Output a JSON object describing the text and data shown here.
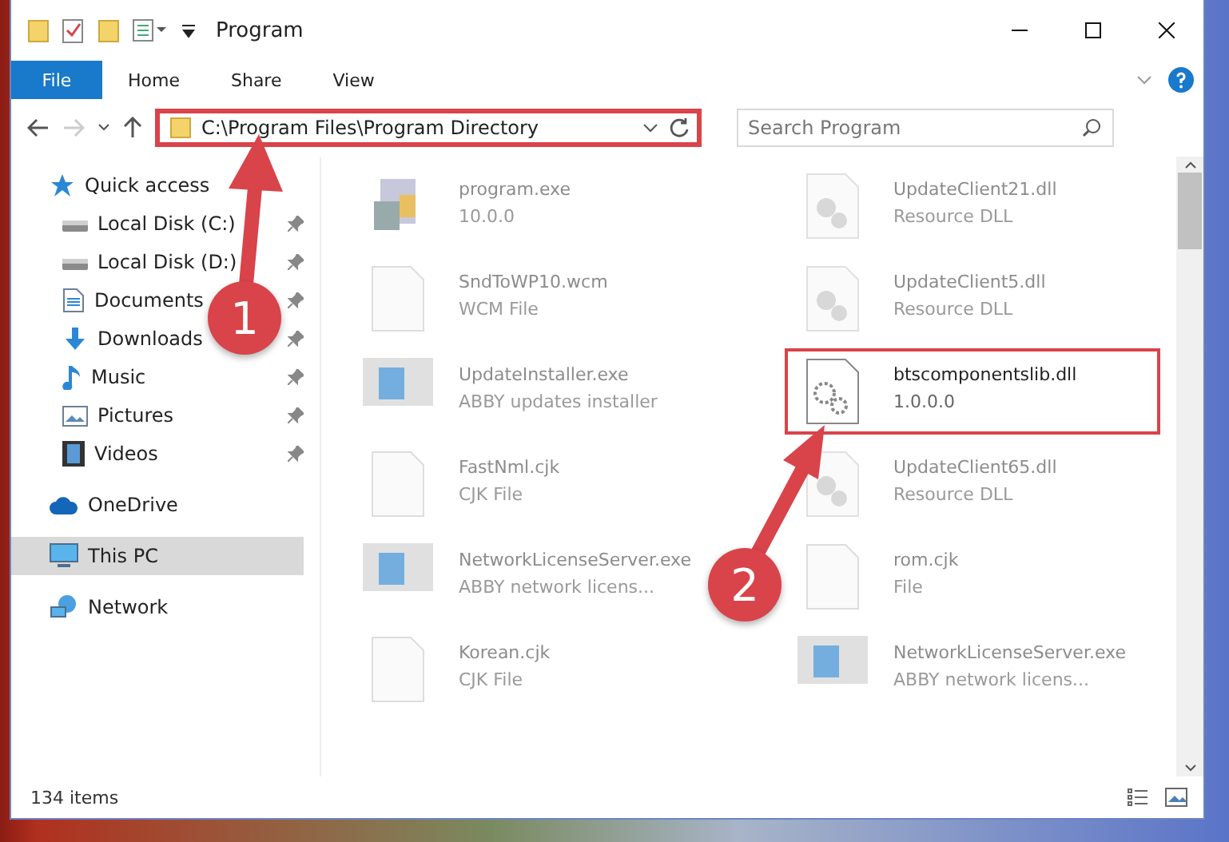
{
  "window": {
    "title": "Program"
  },
  "ribbon_tabs": [
    {
      "label": "File",
      "selected": true
    },
    {
      "label": "Home",
      "selected": false
    },
    {
      "label": "Share",
      "selected": false
    },
    {
      "label": "View",
      "selected": false
    }
  ],
  "address_bar": {
    "path": "C:\\Program Files\\Program Directory",
    "highlighted": true
  },
  "search": {
    "placeholder": "Search Program"
  },
  "sidebar": {
    "items": [
      {
        "label": "Quick access",
        "kind": "star",
        "pinned": false,
        "selected": false,
        "children": [
          {
            "label": "Local Disk (C:)",
            "kind": "disk",
            "pinned": true,
            "selected": false
          },
          {
            "label": "Local Disk (D:)",
            "kind": "disk",
            "pinned": true,
            "selected": false
          },
          {
            "label": "Documents",
            "kind": "document",
            "pinned": true,
            "selected": false
          },
          {
            "label": "Downloads",
            "kind": "download",
            "pinned": true,
            "selected": false
          },
          {
            "label": "Music",
            "kind": "music",
            "pinned": true,
            "selected": false
          },
          {
            "label": "Pictures",
            "kind": "picture",
            "pinned": true,
            "selected": false
          },
          {
            "label": "Videos",
            "kind": "video",
            "pinned": true,
            "selected": false
          }
        ]
      },
      {
        "label": "OneDrive",
        "kind": "cloud",
        "pinned": false,
        "selected": false
      },
      {
        "label": "This PC",
        "kind": "monitor",
        "pinned": false,
        "selected": true
      },
      {
        "label": "Network",
        "kind": "network",
        "pinned": false,
        "selected": false
      }
    ]
  },
  "files": [
    {
      "name": "program.exe",
      "detail": "10.0.0",
      "kind": "app",
      "highlighted": false
    },
    {
      "name": "UpdateClient21.dll",
      "detail": "Resource DLL",
      "kind": "dll",
      "highlighted": false
    },
    {
      "name": "SndToWP10.wcm",
      "detail": "WCM File",
      "kind": "blank",
      "highlighted": false
    },
    {
      "name": "UpdateClient5.dll",
      "detail": "Resource DLL",
      "kind": "dll",
      "highlighted": false
    },
    {
      "name": "UpdateInstaller.exe",
      "detail": "ABBY updates installer",
      "kind": "window",
      "highlighted": false
    },
    {
      "name": "btscomponentslib.dll",
      "detail": "1.0.0.0",
      "kind": "gear",
      "highlighted": true
    },
    {
      "name": "FastNml.cjk",
      "detail": "CJK File",
      "kind": "blank",
      "highlighted": false
    },
    {
      "name": "UpdateClient65.dll",
      "detail": "Resource DLL",
      "kind": "dll",
      "highlighted": false
    },
    {
      "name": "NetworkLicenseServer.exe",
      "detail": "ABBY network licens...",
      "kind": "window",
      "highlighted": false
    },
    {
      "name": "rom.cjk",
      "detail": "File",
      "kind": "blank",
      "highlighted": false
    },
    {
      "name": "Korean.cjk",
      "detail": "CJK File",
      "kind": "blank",
      "highlighted": false
    },
    {
      "name": "NetworkLicenseServer.exe",
      "detail": "ABBY network licens...",
      "kind": "window",
      "highlighted": false
    }
  ],
  "status_bar": {
    "count": "134 items"
  },
  "annotations": [
    {
      "number": "1"
    },
    {
      "number": "2"
    }
  ]
}
